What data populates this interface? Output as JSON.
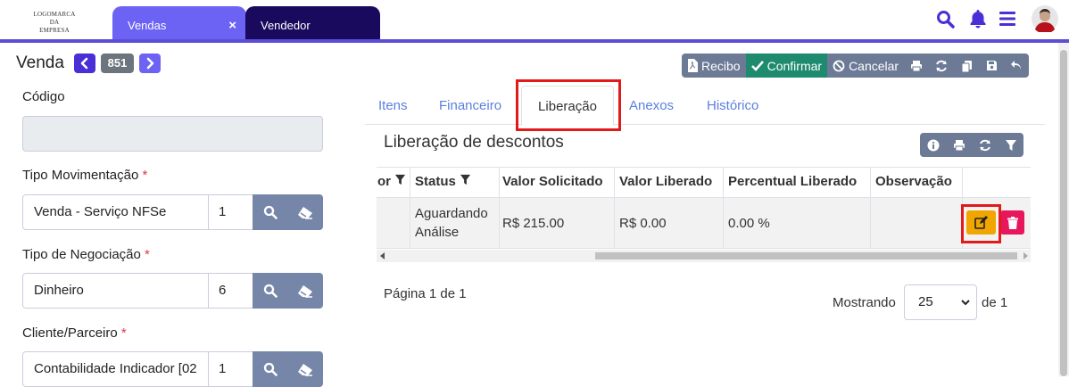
{
  "header": {
    "logo_lines": [
      "LOGOMARCA",
      "DA",
      "EMPRESA"
    ],
    "tabs": [
      {
        "label": "Vendas",
        "close": "×"
      },
      {
        "label": "Vendedor"
      }
    ],
    "icons": [
      "search-icon",
      "bell-icon",
      "menu-icon",
      "user-avatar"
    ]
  },
  "page": {
    "title": "Venda",
    "record_prev": "‹",
    "record_number": "851",
    "record_next": "›"
  },
  "toolbar": {
    "recibo": "Recibo",
    "confirmar": "Confirmar",
    "cancelar": "Cancelar",
    "icons": [
      "print-icon",
      "refresh-icon",
      "copy-icon",
      "save-icon",
      "undo-icon"
    ]
  },
  "form": {
    "codigo": {
      "label": "Código",
      "value": ""
    },
    "tipo_movimentacao": {
      "label": "Tipo Movimentação",
      "required": "*",
      "value": "Venda - Serviço NFSe",
      "code": "1"
    },
    "tipo_negociacao": {
      "label": "Tipo de Negociação",
      "required": "*",
      "value": "Dinheiro",
      "code": "6"
    },
    "cliente": {
      "label": "Cliente/Parceiro",
      "required": "*",
      "value": "Contabilidade Indicador [02",
      "code": "1"
    }
  },
  "tabs": [
    "Itens",
    "Financeiro",
    "Liberação",
    "Anexos",
    "Histórico"
  ],
  "active_tab": "Liberação",
  "section": {
    "title": "Liberação de descontos",
    "icons": [
      "info-icon",
      "print-icon",
      "refresh-icon",
      "filter-icon"
    ]
  },
  "table": {
    "columns": [
      "or",
      "Status",
      "Valor Solicitado",
      "Valor Liberado",
      "Percentual Liberado",
      "Observação"
    ],
    "rows": [
      {
        "col0": "",
        "status": "Aguardando Análise",
        "valor_solicitado": "R$ 215.00",
        "valor_liberado": "R$ 0.00",
        "percentual": "0.00 %",
        "observacao": ""
      }
    ]
  },
  "pagination": {
    "page_info": "Página 1 de 1",
    "showing_label": "Mostrando",
    "page_size": "25",
    "of_label": "de 1"
  },
  "colors": {
    "accent": "#5b4dd8",
    "confirm": "#1e8a6e",
    "edit": "#f0a500",
    "delete": "#e8175d",
    "highlight": "#e21a1a"
  }
}
